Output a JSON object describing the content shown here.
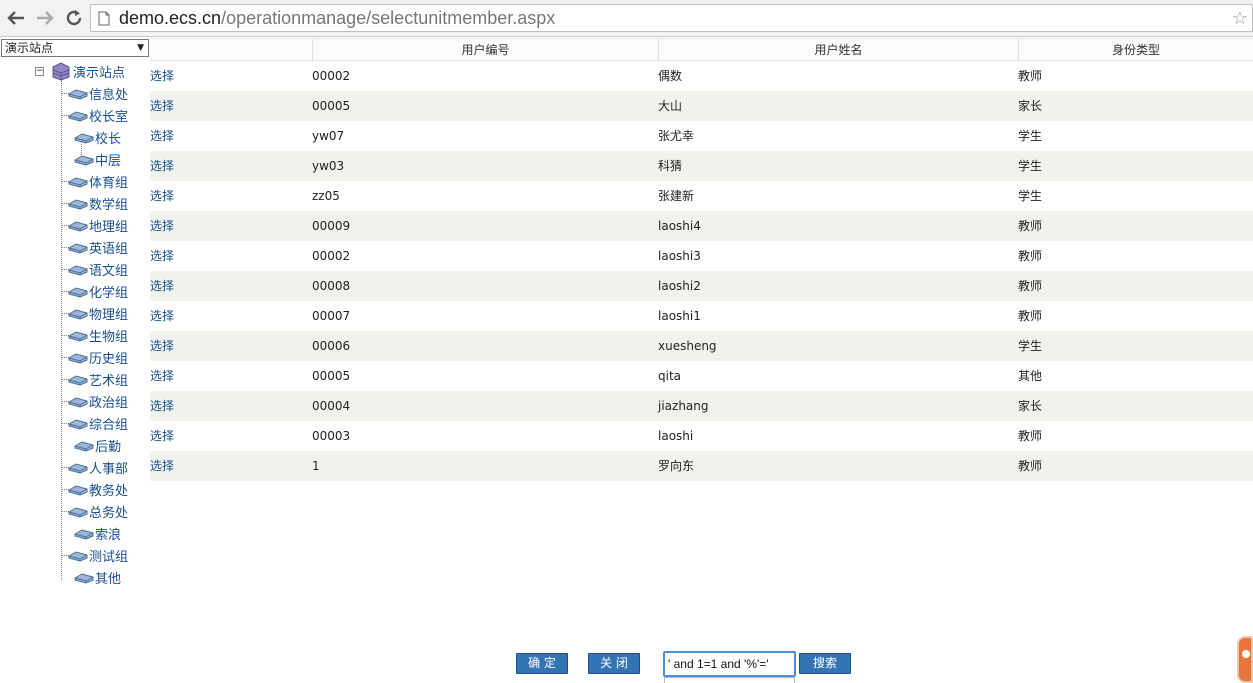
{
  "browser": {
    "url_host": "demo.ecs.cn",
    "url_path": "/operationmanage/selectunitmember.aspx"
  },
  "site_select": {
    "value": "演示站点"
  },
  "tree": {
    "root": "演示站点",
    "nodes": [
      "信息处",
      "校长室",
      "校长",
      "中层",
      "体育组",
      "数学组",
      "地理组",
      "英语组",
      "语文组",
      "化学组",
      "物理组",
      "生物组",
      "历史组",
      "艺术组",
      "政治组",
      "综合组",
      "后勤",
      "人事部",
      "教务处",
      "总务处",
      "索浪",
      "测试组",
      "其他"
    ]
  },
  "table": {
    "headers": [
      "",
      "用户编号",
      "用户姓名",
      "身份类型"
    ],
    "rows": [
      {
        "action": "选择",
        "id": "00002",
        "name": "偶数",
        "type": "教师"
      },
      {
        "action": "选择",
        "id": "00005",
        "name": "大山",
        "type": "家长"
      },
      {
        "action": "选择",
        "id": "yw07",
        "name": "张尤幸",
        "type": "学生"
      },
      {
        "action": "选择",
        "id": "yw03",
        "name": "科猜",
        "type": "学生"
      },
      {
        "action": "选择",
        "id": "zz05",
        "name": "张建新",
        "type": "学生"
      },
      {
        "action": "选择",
        "id": "00009",
        "name": "laoshi4",
        "type": "教师"
      },
      {
        "action": "选择",
        "id": "00002",
        "name": "laoshi3",
        "type": "教师"
      },
      {
        "action": "选择",
        "id": "00008",
        "name": "laoshi2",
        "type": "教师"
      },
      {
        "action": "选择",
        "id": "00007",
        "name": "laoshi1",
        "type": "教师"
      },
      {
        "action": "选择",
        "id": "00006",
        "name": "xuesheng",
        "type": "学生"
      },
      {
        "action": "选择",
        "id": "00005",
        "name": "qita",
        "type": "其他"
      },
      {
        "action": "选择",
        "id": "00004",
        "name": "jiazhang",
        "type": "家长"
      },
      {
        "action": "选择",
        "id": "00003",
        "name": "laoshi",
        "type": "教师"
      },
      {
        "action": "选择",
        "id": "1",
        "name": "罗向东",
        "type": "教师"
      }
    ]
  },
  "footer": {
    "confirm_label": "确 定",
    "close_label": "关 闭",
    "search_value": "' and 1=1 and '%'='",
    "search_label": "搜索"
  },
  "colors": {
    "link": "#1a4f8f",
    "row_alt": "#eff2ed",
    "button": "#3474b4"
  }
}
